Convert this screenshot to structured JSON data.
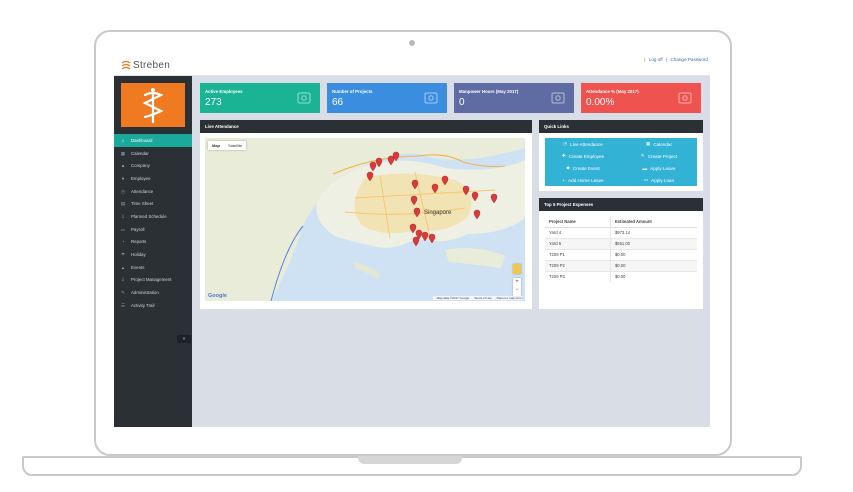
{
  "app": {
    "brand": "Streben",
    "top_links": {
      "logoff": "Log off",
      "separator": "|",
      "change_password": "Change Password"
    }
  },
  "sidebar": {
    "items": [
      {
        "label": "Dashboard",
        "icon": "home-icon",
        "active": true
      },
      {
        "label": "Calendar",
        "icon": "calendar-icon"
      },
      {
        "label": "Company",
        "icon": "company-icon"
      },
      {
        "label": "Employee",
        "icon": "user-icon"
      },
      {
        "label": "Attendance",
        "icon": "clock-icon"
      },
      {
        "label": "Time Sheet",
        "icon": "timesheet-icon"
      },
      {
        "label": "Planned Schedule",
        "icon": "schedule-icon"
      },
      {
        "label": "Payroll",
        "icon": "payroll-icon"
      },
      {
        "label": "Reports",
        "icon": "reports-icon"
      },
      {
        "label": "Holiday",
        "icon": "holiday-icon"
      },
      {
        "label": "Events",
        "icon": "events-icon"
      },
      {
        "label": "Project Management",
        "icon": "project-icon"
      },
      {
        "label": "Administration",
        "icon": "wrench-icon"
      },
      {
        "label": "Activity Trail",
        "icon": "list-icon"
      }
    ],
    "collapse_glyph": "«"
  },
  "cards": [
    {
      "title": "Active Employees",
      "value": "273",
      "color": "#1ab394",
      "icon": "users-icon"
    },
    {
      "title": "Number of Projects",
      "value": "66",
      "color": "#3b8de0",
      "icon": "monitor-icon"
    },
    {
      "title": "Manpower Hours (May 2017)",
      "value": "0",
      "color": "#5f6ca3",
      "icon": "clock-icon"
    },
    {
      "title": "Attendance % (May 2017)",
      "value": "0.00%",
      "color": "#ef5350",
      "icon": "calendar-icon"
    }
  ],
  "live_attendance": {
    "title": "Live Attendance",
    "map_tabs": [
      "Map",
      "Satellite"
    ],
    "city_label": "Singapore",
    "footer": {
      "data": "Map data ©2017 Google",
      "terms": "Terms of Use",
      "report": "Report a map error"
    },
    "google": "Google"
  },
  "quick_links": {
    "title": "Quick Links",
    "items": [
      {
        "label": "Live Attendance",
        "icon": "clock-icon"
      },
      {
        "label": "Calendar",
        "icon": "calendar-icon"
      },
      {
        "label": "Create Employee",
        "icon": "user-plus-icon"
      },
      {
        "label": "Create Project",
        "icon": "wrench-icon"
      },
      {
        "label": "Create Event",
        "icon": "event-icon"
      },
      {
        "label": "Apply Leave",
        "icon": "leave-icon"
      },
      {
        "label": "Add Home Leave",
        "icon": "plus-icon"
      },
      {
        "label": "Apply Loan",
        "icon": "loan-icon"
      }
    ]
  },
  "expenses": {
    "title": "Top 5 Project Expenses",
    "columns": [
      "Project Name",
      "Estimated Amount"
    ],
    "rows": [
      [
        "Yard 4",
        "$973.14"
      ],
      [
        "Yard 6",
        "$551.00"
      ],
      [
        "T209 P1",
        "$0.00"
      ],
      [
        "T209 P2",
        "$0.00"
      ],
      [
        "T209 P3",
        "$0.00"
      ]
    ]
  }
}
